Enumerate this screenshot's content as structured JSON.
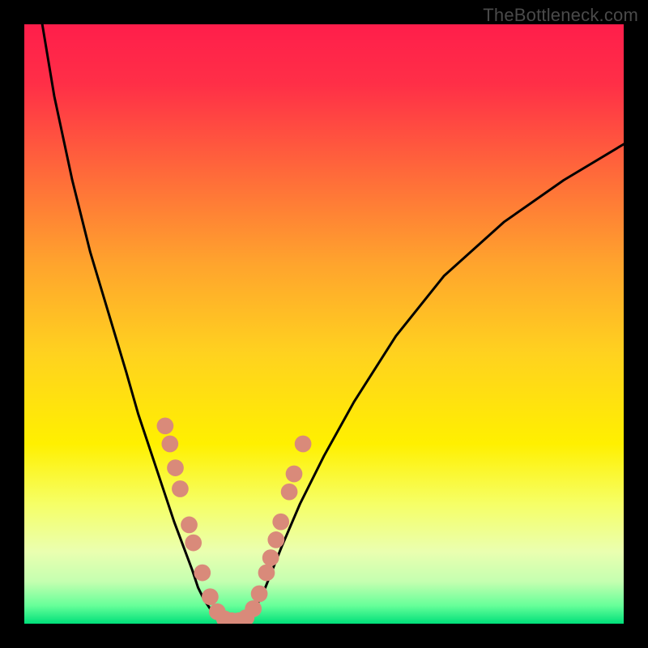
{
  "watermark": "TheBottleneck.com",
  "chart_data": {
    "type": "line",
    "title": "",
    "xlabel": "",
    "ylabel": "",
    "xlim": [
      0,
      100
    ],
    "ylim": [
      0,
      100
    ],
    "gradient_stops": [
      {
        "offset": 0.0,
        "color": "#ff1e4b"
      },
      {
        "offset": 0.1,
        "color": "#ff2f47"
      },
      {
        "offset": 0.25,
        "color": "#ff6a3a"
      },
      {
        "offset": 0.4,
        "color": "#ffa42d"
      },
      {
        "offset": 0.55,
        "color": "#ffd21f"
      },
      {
        "offset": 0.7,
        "color": "#fff000"
      },
      {
        "offset": 0.8,
        "color": "#f6ff66"
      },
      {
        "offset": 0.88,
        "color": "#eaffb0"
      },
      {
        "offset": 0.93,
        "color": "#c4ffb0"
      },
      {
        "offset": 0.97,
        "color": "#66ff99"
      },
      {
        "offset": 1.0,
        "color": "#00e07a"
      }
    ],
    "series": [
      {
        "name": "left-curve",
        "x": [
          3,
          5,
          8,
          11,
          14,
          17,
          19,
          21,
          23,
          25,
          26.5,
          28,
          29,
          30,
          31,
          32,
          33
        ],
        "y": [
          100,
          88,
          74,
          62,
          52,
          42,
          35,
          29,
          23,
          17,
          13,
          9,
          6,
          4,
          2.5,
          1.3,
          0.6
        ]
      },
      {
        "name": "right-curve",
        "x": [
          37,
          38,
          39,
          40,
          41,
          43,
          46,
          50,
          55,
          62,
          70,
          80,
          90,
          100
        ],
        "y": [
          0.6,
          1.8,
          3.5,
          5.5,
          8,
          13,
          20,
          28,
          37,
          48,
          58,
          67,
          74,
          80
        ]
      }
    ],
    "markers": {
      "name": "highlighted-points",
      "color": "#d98a7a",
      "radius_pct": 1.4,
      "points": [
        {
          "x": 23.5,
          "y": 33
        },
        {
          "x": 24.3,
          "y": 30
        },
        {
          "x": 25.2,
          "y": 26
        },
        {
          "x": 26.0,
          "y": 22.5
        },
        {
          "x": 27.5,
          "y": 16.5
        },
        {
          "x": 28.2,
          "y": 13.5
        },
        {
          "x": 29.7,
          "y": 8.5
        },
        {
          "x": 31.0,
          "y": 4.5
        },
        {
          "x": 32.2,
          "y": 2.0
        },
        {
          "x": 33.4,
          "y": 0.8
        },
        {
          "x": 34.6,
          "y": 0.5
        },
        {
          "x": 35.8,
          "y": 0.5
        },
        {
          "x": 37.0,
          "y": 1.0
        },
        {
          "x": 38.2,
          "y": 2.5
        },
        {
          "x": 39.2,
          "y": 5.0
        },
        {
          "x": 40.4,
          "y": 8.5
        },
        {
          "x": 41.1,
          "y": 11.0
        },
        {
          "x": 42.0,
          "y": 14.0
        },
        {
          "x": 42.8,
          "y": 17.0
        },
        {
          "x": 44.2,
          "y": 22.0
        },
        {
          "x": 45.0,
          "y": 25.0
        },
        {
          "x": 46.5,
          "y": 30.0
        }
      ]
    }
  }
}
